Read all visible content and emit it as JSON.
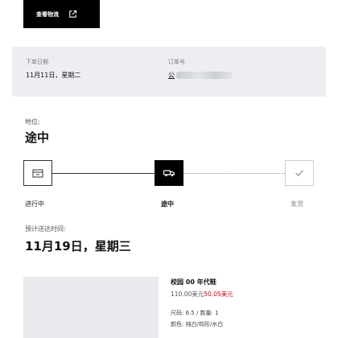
{
  "header": {
    "track_button_label": "查看物流"
  },
  "order_info": {
    "date_label": "下单日期",
    "date_value": "11月11日，星期二",
    "order_label": "订单号",
    "order_value_visible": "公"
  },
  "status": {
    "label": "地位:",
    "value": "途中"
  },
  "stepper": {
    "current_index": 1,
    "steps": [
      {
        "label": "进行中",
        "icon": "box-icon"
      },
      {
        "label": "途中",
        "icon": "truck-icon"
      },
      {
        "label": "发货",
        "icon": "check-icon"
      }
    ]
  },
  "eta": {
    "label": "预计送达时间:",
    "value": "11月19日，星期三"
  },
  "product": {
    "name": "校园 00 年代鞋",
    "original_price": "110.00美元",
    "sale_price": "50.05美元",
    "spec": "尺码: 6.5 / 数量: 1",
    "color": "颜色: 纯白/钩形/水白"
  },
  "colors": {
    "accent": "#000000",
    "info_bar_bg": "#eceef1",
    "sale_price": "#d0021b"
  }
}
